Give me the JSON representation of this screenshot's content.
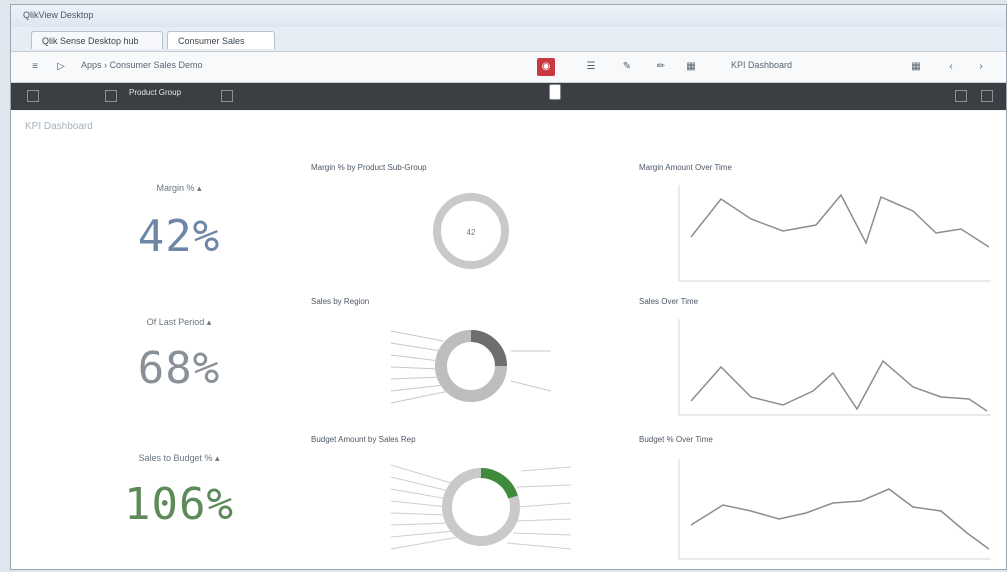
{
  "window": {
    "title": "QlikView Desktop"
  },
  "tabs": [
    {
      "label": "Qlik Sense Desktop hub"
    },
    {
      "label": "Consumer Sales"
    }
  ],
  "toolbar": {
    "address": "Apps › Consumer Sales Demo",
    "sheet_name": "KPI Dashboard"
  },
  "darkbar": {
    "sheet_selector": "Product Group"
  },
  "sheet": {
    "title": "KPI Dashboard"
  },
  "kpis": [
    {
      "label": "Margin % ▴",
      "value": "42%",
      "color": "#6f87a6"
    },
    {
      "label": "Of Last Period ▴",
      "value": "68%",
      "color": "#8a9097"
    },
    {
      "label": "Sales to Budget % ▴",
      "value": "106%",
      "color": "#5e8a5a"
    }
  ],
  "charts": {
    "margin_by_product": {
      "title": "Margin % by Product Sub-Group",
      "center": "42"
    },
    "sales_by_region": {
      "title": "Sales by Region"
    },
    "budget_by_rep": {
      "title": "Budget Amount by Sales Rep"
    },
    "margin_over_time": {
      "title": "Margin Amount Over Time"
    },
    "sales_over_time": {
      "title": "Sales Over Time"
    },
    "budget_over_time": {
      "title": "Budget % Over Time"
    }
  },
  "colors": {
    "accent_green": "#3f8a3b",
    "ring_gray": "#b9b9b9",
    "dark_bar": "#3b3f44"
  }
}
